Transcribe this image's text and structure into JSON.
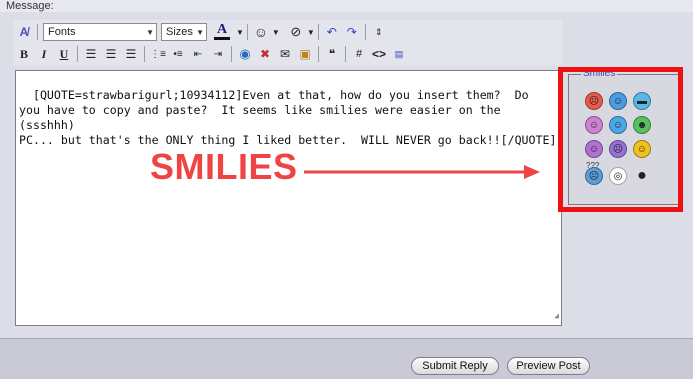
{
  "message_label": "Message:",
  "toolbar": {
    "font_select": "Fonts",
    "size_select": "Sizes",
    "font_color_letter": "A"
  },
  "editor": {
    "content": "[QUOTE=strawbarigurl;10934112]Even at that, how do you insert them?  Do\nyou have to copy and paste?  It seems like smilies were easier on the (ssshhh)\nPC... but that's the ONLY thing I liked better.  WILL NEVER go back!![/QUOTE]"
  },
  "smilies": {
    "title": "Smilies",
    "confused_mark": "???",
    "items": [
      {
        "name": "mad",
        "color": "#e85a4a"
      },
      {
        "name": "cool-glasses",
        "color": "#4a9ce0"
      },
      {
        "name": "shades",
        "color": "#58b8e8"
      },
      {
        "name": "tongue",
        "color": "#d080d0"
      },
      {
        "name": "smile-blue",
        "color": "#4aa8e8"
      },
      {
        "name": "grin",
        "color": "#58c060"
      },
      {
        "name": "wink-purple",
        "color": "#b070d0"
      },
      {
        "name": "frown-purple",
        "color": "#9870d8"
      },
      {
        "name": "smile",
        "color": "#f0c020"
      },
      {
        "name": "confused",
        "color": "#5aa0d8"
      },
      {
        "name": "shocked",
        "color": "#ffffff"
      },
      {
        "name": "apple",
        "color": "#222222"
      }
    ]
  },
  "annotation": {
    "label": "SMILIES",
    "color": "#ee1111"
  },
  "buttons": {
    "submit": "Submit Reply",
    "preview": "Preview Post"
  }
}
